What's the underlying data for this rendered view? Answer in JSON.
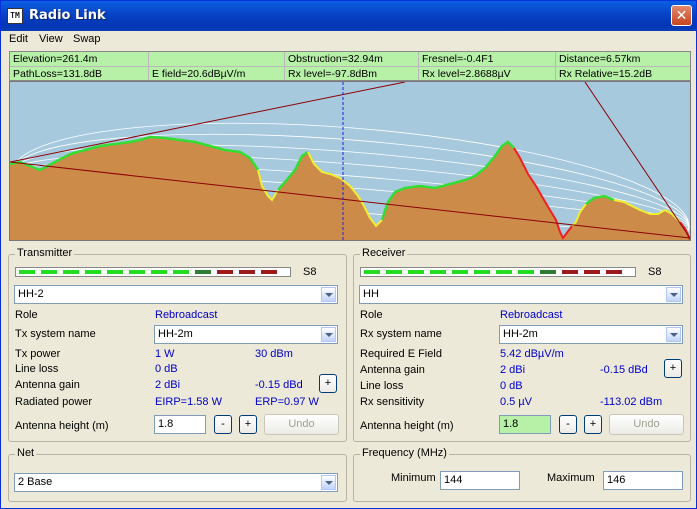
{
  "window": {
    "title": "Radio Link",
    "icon_text": "TM"
  },
  "menu": [
    "Edit",
    "View",
    "Swap"
  ],
  "info": {
    "row1": [
      "Elevation=261.4m",
      "",
      "Obstruction=32.94m",
      "Fresnel=-0.4F1",
      "Distance=6.57km"
    ],
    "row2": [
      "PathLoss=131.8dB",
      "E field=20.6dBµV/m",
      "Rx level=-97.8dBm",
      "Rx level=2.8688µV",
      "Rx Relative=15.2dB"
    ]
  },
  "transmitter": {
    "group_title": "Transmitter",
    "s_meter": "S8",
    "unit": "HH-2",
    "rows": [
      {
        "label": "Role",
        "value": "Rebroadcast",
        "value2": ""
      },
      {
        "label": "Tx system name",
        "value": "",
        "value2": ""
      },
      {
        "label": "Tx power",
        "value": "1 W",
        "value2": "30 dBm"
      },
      {
        "label": "Line loss",
        "value": "0 dB",
        "value2": ""
      },
      {
        "label": "Antenna gain",
        "value": "2 dBi",
        "value2": "-0.15 dBd"
      },
      {
        "label": "Radiated power",
        "value": "EIRP=1.58 W",
        "value2": "ERP=0.97 W"
      }
    ],
    "system_name": "HH-2m",
    "antenna_height_label": "Antenna height (m)",
    "antenna_height": "1.8",
    "minus": "-",
    "plus": "+",
    "undo": "Undo"
  },
  "receiver": {
    "group_title": "Receiver",
    "s_meter": "S8",
    "unit": "HH",
    "rows": [
      {
        "label": "Role",
        "value": "Rebroadcast",
        "value2": ""
      },
      {
        "label": "Rx system name",
        "value": "",
        "value2": ""
      },
      {
        "label": "Required E Field",
        "value": "5.42 dBµV/m",
        "value2": ""
      },
      {
        "label": "Antenna gain",
        "value": "2 dBi",
        "value2": "-0.15 dBd"
      },
      {
        "label": "Line loss",
        "value": "0 dB",
        "value2": ""
      },
      {
        "label": "Rx sensitivity",
        "value": "0.5 µV",
        "value2": "-113.02 dBm"
      }
    ],
    "system_name": "HH-2m",
    "antenna_height_label": "Antenna height (m)",
    "antenna_height": "1.8",
    "minus": "-",
    "plus": "+",
    "undo": "Undo"
  },
  "net": {
    "group_title": "Net",
    "value": "2 Base"
  },
  "frequency": {
    "group_title": "Frequency (MHz)",
    "min_label": "Minimum",
    "min": "144",
    "max_label": "Maximum",
    "max": "146"
  },
  "colors": {
    "terrain_fill": "#CD8B4A",
    "sky": "#A6C9DE",
    "profile_clear": "#33DD33",
    "profile_partial": "#EEEE33",
    "profile_obstructed": "#EE2020",
    "meter_green": "#22DD22",
    "meter_dark": "#2E7D32",
    "meter_red": "#9B1B1B"
  }
}
